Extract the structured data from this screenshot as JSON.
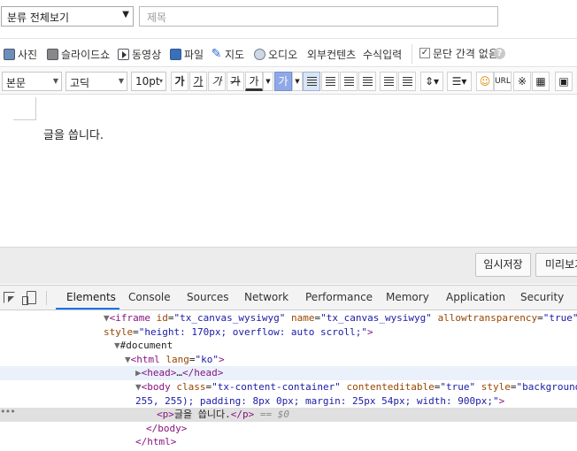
{
  "top": {
    "category_value": "분류 전체보기",
    "title_placeholder": "제목"
  },
  "attach": {
    "items": [
      {
        "label": "사진",
        "icon": "photo-icon"
      },
      {
        "label": "슬라이드쇼",
        "icon": "slideshow-icon"
      },
      {
        "label": "동영상",
        "icon": "video-icon"
      },
      {
        "label": "파일",
        "icon": "file-icon"
      },
      {
        "label": "지도",
        "icon": "map-icon"
      },
      {
        "label": "오디오",
        "icon": "audio-icon"
      },
      {
        "label": "외부컨텐츠",
        "icon": ""
      },
      {
        "label": "수식입력",
        "icon": ""
      }
    ],
    "paragraph_checkbox_label": "문단 간격 없음",
    "paragraph_checked": true,
    "help_glyph": "?"
  },
  "format": {
    "style_value": "본문",
    "font_value": "고딕",
    "size_value": "10pt",
    "bold": "가",
    "underline": "가",
    "italic": "가",
    "strike": "가",
    "text_color": "가",
    "bg_color": "가",
    "url": "URL",
    "special_char": "※"
  },
  "editor": {
    "body_text": "글을 씁니다."
  },
  "save_bar": {
    "temp_save": "임시저장",
    "preview": "미리보기"
  },
  "devtools": {
    "tabs": [
      "Elements",
      "Console",
      "Sources",
      "Network",
      "Performance",
      "Memory",
      "Application",
      "Security"
    ],
    "active_tab": "Elements",
    "dots": "•••",
    "dom": {
      "l1_tag": "iframe",
      "l1_a1": "id",
      "l1_v1": "\"tx_canvas_wysiwyg\"",
      "l1_a2": "name",
      "l1_v2": "\"tx_canvas_wysiwyg\"",
      "l1_a3": "allowtransparency",
      "l1_v3": "\"true\"",
      "l2_a": "style",
      "l2_v": "\"height: 170px; overflow: auto scroll;\"",
      "l3_text": "#document",
      "l4_tag": "html",
      "l4_a": "lang",
      "l4_v": "\"ko\"",
      "l5_open": "<head>",
      "l5_ell": "…",
      "l5_close": "</head>",
      "l6_tag": "body",
      "l6_a1": "class",
      "l6_v1": "\"tx-content-container\"",
      "l6_a2": "contenteditable",
      "l6_v2": "\"true\"",
      "l6_a3": "style",
      "l6_v3": "\"background",
      "l7_v": "255, 255); padding: 8px 0px; margin: 25px 54px; width: 900px;\"",
      "l8_open": "<p>",
      "l8_text": "글을 씁니다.",
      "l8_close": "</p>",
      "l8_cmt": "== $0",
      "l9": "</body>",
      "l10": "</html>"
    }
  }
}
